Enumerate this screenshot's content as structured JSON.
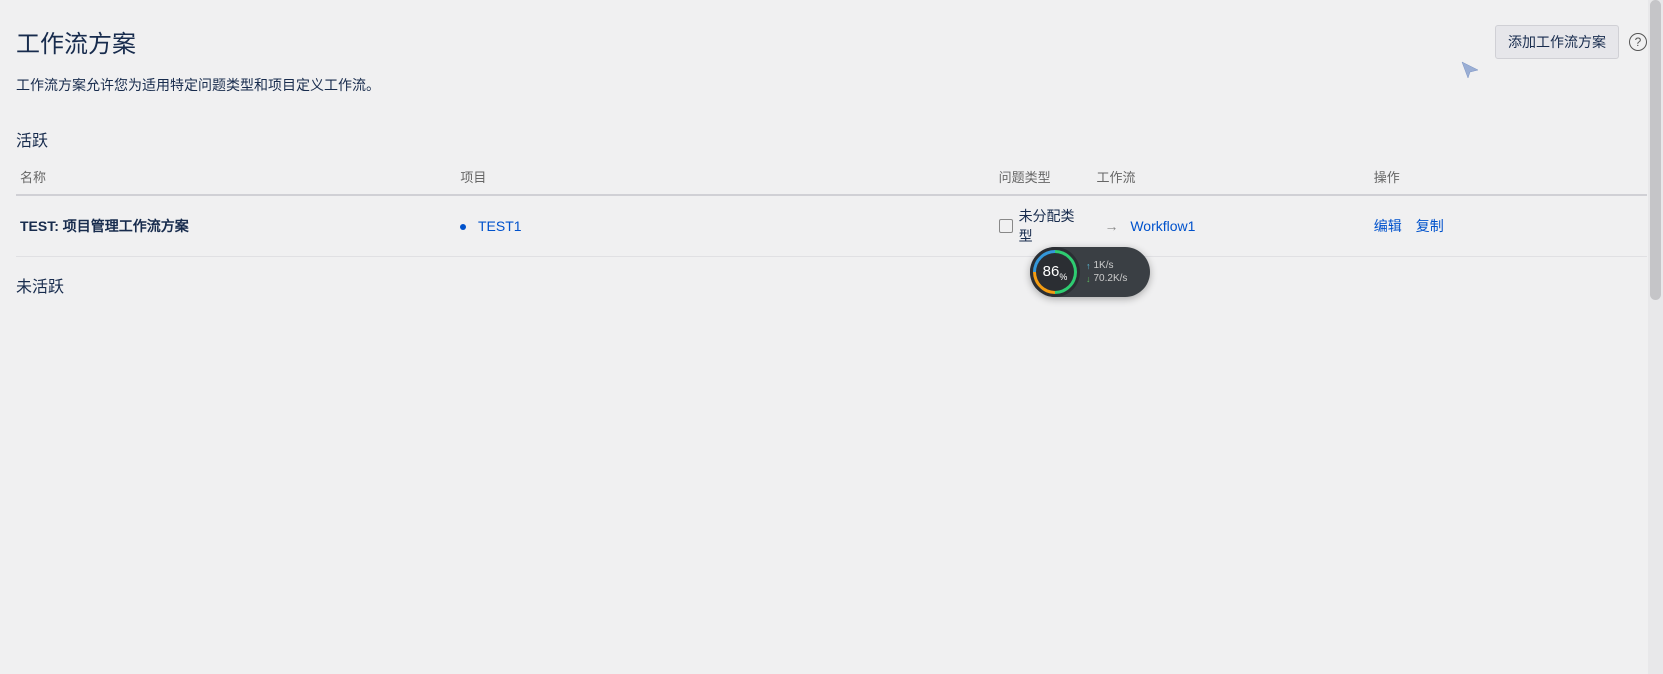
{
  "header": {
    "title": "工作流方案",
    "add_button": "添加工作流方案",
    "help_glyph": "?"
  },
  "description": "工作流方案允许您为适用特定问题类型和项目定义工作流。",
  "active_section": {
    "title": "活跃",
    "columns": {
      "name": "名称",
      "project": "项目",
      "issue_type": "问题类型",
      "workflow": "工作流",
      "actions": "操作"
    },
    "rows": [
      {
        "name": "TEST: 项目管理工作流方案",
        "project": "TEST1",
        "issue_type": "未分配类型",
        "arrow": "→",
        "workflow": "Workflow1",
        "action_edit": "编辑",
        "action_copy": "复制"
      }
    ]
  },
  "inactive_section": {
    "title": "未活跃"
  },
  "net_widget": {
    "percent": "86",
    "percent_suffix": "%",
    "up": "1K/s",
    "down": "70.2K/s"
  }
}
